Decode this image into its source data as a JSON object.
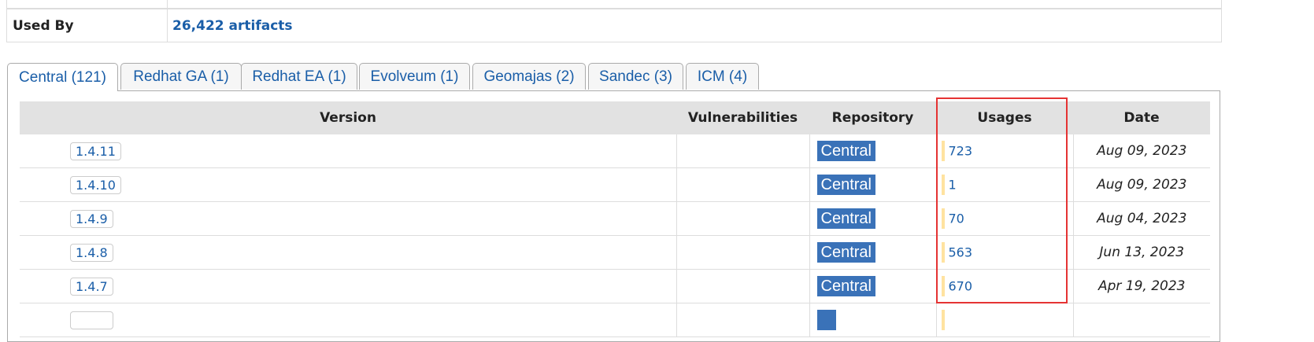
{
  "info": {
    "used_by_label": "Used By",
    "used_by_value": "26,422 artifacts"
  },
  "tabs": [
    {
      "label": "Central (121)",
      "active": true
    },
    {
      "label": "Redhat GA (1)",
      "active": false
    },
    {
      "label": "Redhat EA (1)",
      "active": false
    },
    {
      "label": "Evolveum (1)",
      "active": false
    },
    {
      "label": "Geomajas (2)",
      "active": false
    },
    {
      "label": "Sandec (3)",
      "active": false
    },
    {
      "label": "ICM (4)",
      "active": false
    }
  ],
  "table": {
    "headers": {
      "version": "Version",
      "vulnerabilities": "Vulnerabilities",
      "repository": "Repository",
      "usages": "Usages",
      "date": "Date"
    },
    "rows": [
      {
        "version": "1.4.11",
        "repository": "Central",
        "usages": "723",
        "date": "Aug 09, 2023"
      },
      {
        "version": "1.4.10",
        "repository": "Central",
        "usages": "1",
        "date": "Aug 09, 2023"
      },
      {
        "version": "1.4.9",
        "repository": "Central",
        "usages": "70",
        "date": "Aug 04, 2023"
      },
      {
        "version": "1.4.8",
        "repository": "Central",
        "usages": "563",
        "date": "Jun 13, 2023"
      },
      {
        "version": "1.4.7",
        "repository": "Central",
        "usages": "670",
        "date": "Apr 19, 2023"
      }
    ]
  },
  "colors": {
    "link": "#1a5ea8",
    "badge": "#3a72b8",
    "header_bg": "#e2e2e2",
    "usage_bar": "#ffe3a0",
    "highlight": "#e53333"
  }
}
